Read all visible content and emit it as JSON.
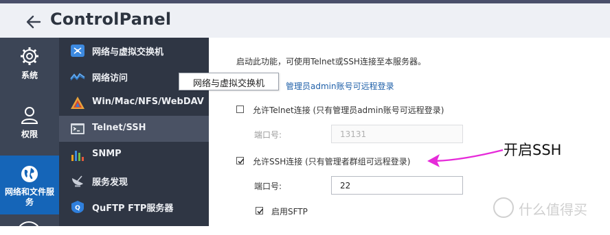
{
  "titlebar": {
    "title": "ControlPanel"
  },
  "rail": [
    {
      "label": "系统",
      "icon": "gear-icon"
    },
    {
      "label": "权限",
      "icon": "user-icon"
    },
    {
      "label": "网络和文件服务",
      "icon": "globe-icon",
      "active": true
    }
  ],
  "submenu": [
    {
      "label": "网络与虚拟交换机",
      "icon": "network-switch-icon"
    },
    {
      "label": "网络访问",
      "icon": "network-access-icon"
    },
    {
      "label": "Win/Mac/NFS/WebDAV",
      "icon": "os-share-icon"
    },
    {
      "label": "Telnet/SSH",
      "icon": "terminal-icon",
      "selected": true
    },
    {
      "label": "SNMP",
      "icon": "snmp-chart-icon"
    },
    {
      "label": "服务发现",
      "icon": "satellite-icon"
    },
    {
      "label": "QuFTP FTP服务器",
      "icon": "ftp-icon"
    }
  ],
  "tooltip": {
    "text": "网络与虚拟交换机"
  },
  "main": {
    "description": "启动此功能，可使用Telnet或SSH连接至本服务器。",
    "note_link": "管理员admin账号可远程登录",
    "telnet": {
      "label": "允许Telnet连接 (只有管理员admin账号可远程登录)",
      "checked": false,
      "port_label": "端口号:",
      "port_value": "13131"
    },
    "ssh": {
      "label": "允许SSH连接 (只有管理者群组可远程登录)",
      "checked": true,
      "port_label": "端口号:",
      "port_value": "22"
    },
    "sftp": {
      "label": "启用SFTP",
      "checked": true
    }
  },
  "annotation": {
    "text": "开启SSH",
    "color": "#e62ad9"
  },
  "watermark": {
    "text": "什么值得买",
    "logo_text": "值"
  }
}
